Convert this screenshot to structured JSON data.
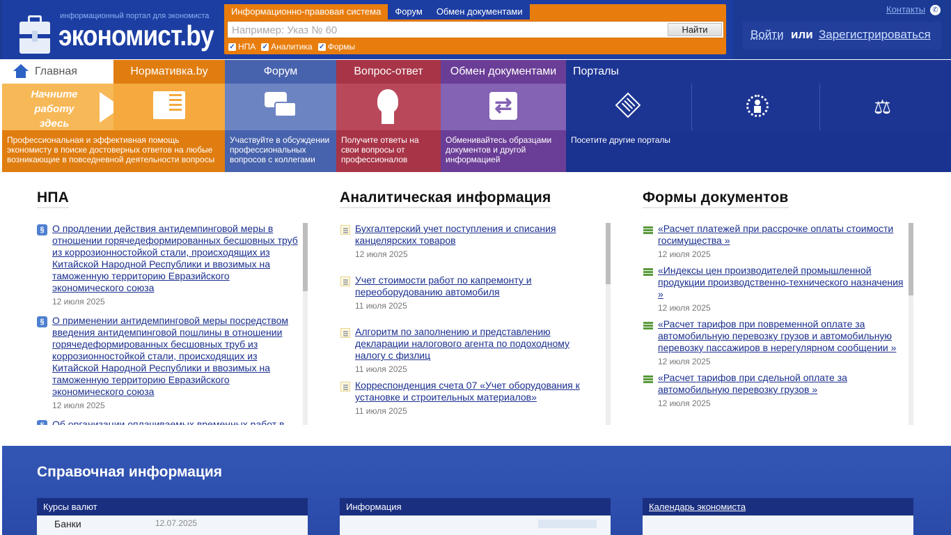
{
  "header": {
    "tagline": "информационный портал для экономиста",
    "site_name": "экономист.by",
    "search": {
      "tabs": [
        "Информационно-правовая система",
        "Форум",
        "Обмен документами"
      ],
      "placeholder": "Например: Указ № 60",
      "button": "Найти",
      "filters": [
        "НПА",
        "Аналитика",
        "Формы"
      ]
    },
    "contacts": "Контакты",
    "auth": {
      "login": "Войти",
      "or": "или",
      "register": "Зарегистрироваться"
    }
  },
  "nav": {
    "home": "Главная",
    "items": [
      "Нормативка.by",
      "Форум",
      "Вопрос-ответ",
      "Обмен документами",
      "Порталы"
    ]
  },
  "tiles": {
    "start_text": [
      "Начните",
      "работу",
      "здесь"
    ],
    "normativka": "Профессиональная и эффективная помощь экономисту в поиске достоверных ответов на любые возникающие в повседневной деятельности вопросы",
    "forum": "Участвуйте в обсуждении профессиональных вопросов с коллегами",
    "qa": "Получите ответы на свои вопросы от профессионалов",
    "exchange": "Обменивайтесь образцами документов и другой информацией",
    "portals": "Посетите другие порталы"
  },
  "columns": {
    "npa": {
      "title": "НПА",
      "items": [
        {
          "text": "О продлении действия антидемпинговой меры в отношении горячедеформированных бесшовных труб из коррозионностойкой стали, происходящих из Китайской Народной Республики и ввозимых на таможенную территорию Евразийского экономического союза",
          "date": "12 июля 2025"
        },
        {
          "text": "О применении антидемпинговой меры посредством введения антидемпинговой пошлины в отношении горячедеформированных бесшовных труб из коррозионностойкой стали, происходящих из Китайской Народной Республики и ввозимых на таможенную территорию Евразийского экономического союза",
          "date": "12 июля 2025"
        },
        {
          "text": "Об организации оплачиваемых временных работ в",
          "date": ""
        }
      ]
    },
    "analytics": {
      "title": "Аналитическая информация",
      "items": [
        {
          "text": "Бухгалтерский учет поступления и списания канцелярских товаров",
          "date": "12 июля 2025"
        },
        {
          "text": "Учет стоимости работ по капремонту и переоборудованию автомобиля",
          "date": "11 июля 2025"
        },
        {
          "text": "Алгоритм по заполнению и представлению декларации налогового агента по подоходному налогу с физлиц",
          "date": "11 июля 2025"
        },
        {
          "text": "Корреспонденция счета 07 «Учет оборудования к установке и строительных материалов»",
          "date": "11 июля 2025"
        }
      ]
    },
    "forms": {
      "title": "Формы документов",
      "items": [
        {
          "text": "«Расчет платежей при рассрочке оплаты стоимости госимущества »",
          "date": "12 июля 2025"
        },
        {
          "text": "«Индексы цен производителей промышленной продукции производственно-технического назначения »",
          "date": "12 июля 2025"
        },
        {
          "text": "«Расчет тарифов при повременной оплате за автомобильную перевозку грузов и автомобильную перевозку пассажиров в нерегулярном сообщении »",
          "date": "12 июля 2025"
        },
        {
          "text": "«Расчет тарифов при сдельной оплате за автомобильную перевозку грузов »",
          "date": "12 июля 2025"
        }
      ]
    }
  },
  "reference": {
    "title": "Справочная информация",
    "panels": [
      "Курсы валют",
      "Информация",
      "Календарь экономиста"
    ],
    "banks_label": "Банки",
    "banks_date": "12.07.2025"
  }
}
